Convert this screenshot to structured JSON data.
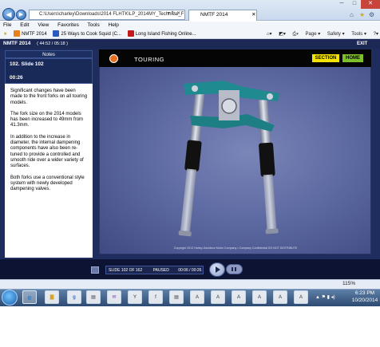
{
  "browser": {
    "address": "C:\\Users\\charley\\Downloads\\2014 FLHTK\\LP_2014MY_Technical_F",
    "tab_title": "NMTF 2014",
    "menu": [
      "File",
      "Edit",
      "View",
      "Favorites",
      "Tools",
      "Help"
    ],
    "favorites": [
      {
        "label": "NMTF 2014",
        "color": "#e8801c"
      },
      {
        "label": "25 Ways to Cook Squid (C...",
        "color": "#2a5bbf"
      },
      {
        "label": "Long Island Fishing Online...",
        "color": "#c21a1a"
      }
    ],
    "commands": [
      "Page ▾",
      "Safety ▾",
      "Tools ▾"
    ],
    "zoom": "115%"
  },
  "app": {
    "header": "NMTF 2014",
    "header_time": "( 44:52 / 05:18 )",
    "exit": "EXIT",
    "notes_tab": "Notes",
    "slide_label": "102. Slide 102",
    "slide_elapsed": "00:26",
    "notes": [
      "Significant changes have been made to the front forks on all touring models.",
      "The fork size on the 2014 models has been increased to 49mm from 41.3mm.",
      "In addition to the increase in diameter, the internal dampening components have also been re-tuned to provide a controlled and smooth ride over a wider variety of surfaces.",
      "Both forks use a conventional style system with newly developed dampening valves."
    ],
    "slide_title": "TOURING",
    "section_btn": "SECTION",
    "home_btn": "HOME",
    "copyright": "Copyright 2013 Harley-Davidson Motor Company • Company Confidential DO NOT DISTRIBUTE",
    "progress": {
      "slide": "SLIDE 102 OF 162",
      "status": "PAUSED",
      "time": "00:06 / 00:26"
    }
  },
  "taskbar": {
    "time": "6:23 PM",
    "date": "10/20/2014"
  },
  "colors": {
    "section": "#f5e400",
    "home": "#7ec02a",
    "touring_logo": "#e87022"
  }
}
